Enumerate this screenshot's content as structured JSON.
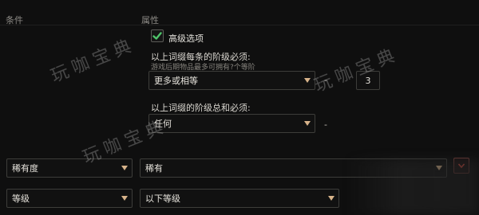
{
  "headers": {
    "condition": "条件",
    "attribute": "属性"
  },
  "advanced": {
    "label": "高级选项",
    "checked": true
  },
  "affix_each": {
    "label": "以上词缀每条的阶级必须:",
    "hint": "游戏后期物品最多可拥有?个等阶",
    "operator": "更多或相等",
    "dash": "-",
    "value": "3"
  },
  "affix_total": {
    "label": "以上词缀的阶级总和必须:",
    "operator": "任何",
    "dash": "-"
  },
  "rows": [
    {
      "condition": "稀有度",
      "attribute": "稀有"
    },
    {
      "condition": "等级",
      "attribute": "以下等级"
    }
  ],
  "watermark": "玩咖宝典",
  "colors": {
    "accent_check": "#4fc46a",
    "arrow": "#d7b38a",
    "remove": "#d64a3f"
  }
}
